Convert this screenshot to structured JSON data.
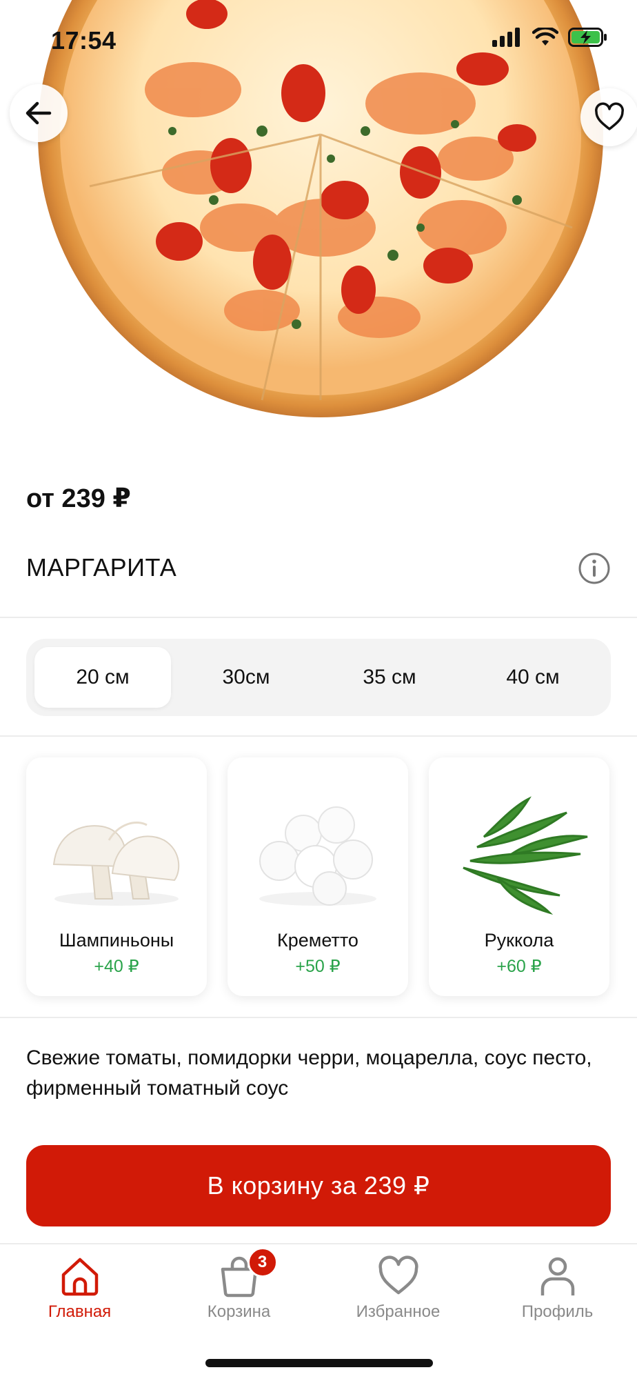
{
  "status_bar": {
    "time": "17:54"
  },
  "product": {
    "price": "от 239 ₽",
    "name": "МАРГАРИТА",
    "description": "Свежие томаты, помидорки черри, моцарелла, соус песто, фирменный томатный соус"
  },
  "sizes": {
    "selected": "20 см",
    "options": [
      "20 см",
      "30см",
      "35 см",
      "40 см"
    ]
  },
  "addons": [
    {
      "name": "Шампиньоны",
      "price": "+40 ₽"
    },
    {
      "name": "Креметто",
      "price": "+50 ₽"
    },
    {
      "name": "Руккола",
      "price": "+60 ₽"
    }
  ],
  "cta": {
    "label": "В корзину за 239 ₽"
  },
  "tabbar": {
    "active": "home",
    "items": [
      {
        "label": "Главная",
        "icon": "home-icon"
      },
      {
        "label": "Корзина",
        "icon": "basket-icon",
        "badge": "3"
      },
      {
        "label": "Избранное",
        "icon": "heart-icon"
      },
      {
        "label": "Профиль",
        "icon": "user-icon"
      }
    ]
  },
  "colors": {
    "accent": "#d11a07",
    "addon_price": "#2aa34a",
    "muted": "#8a8a8a"
  }
}
